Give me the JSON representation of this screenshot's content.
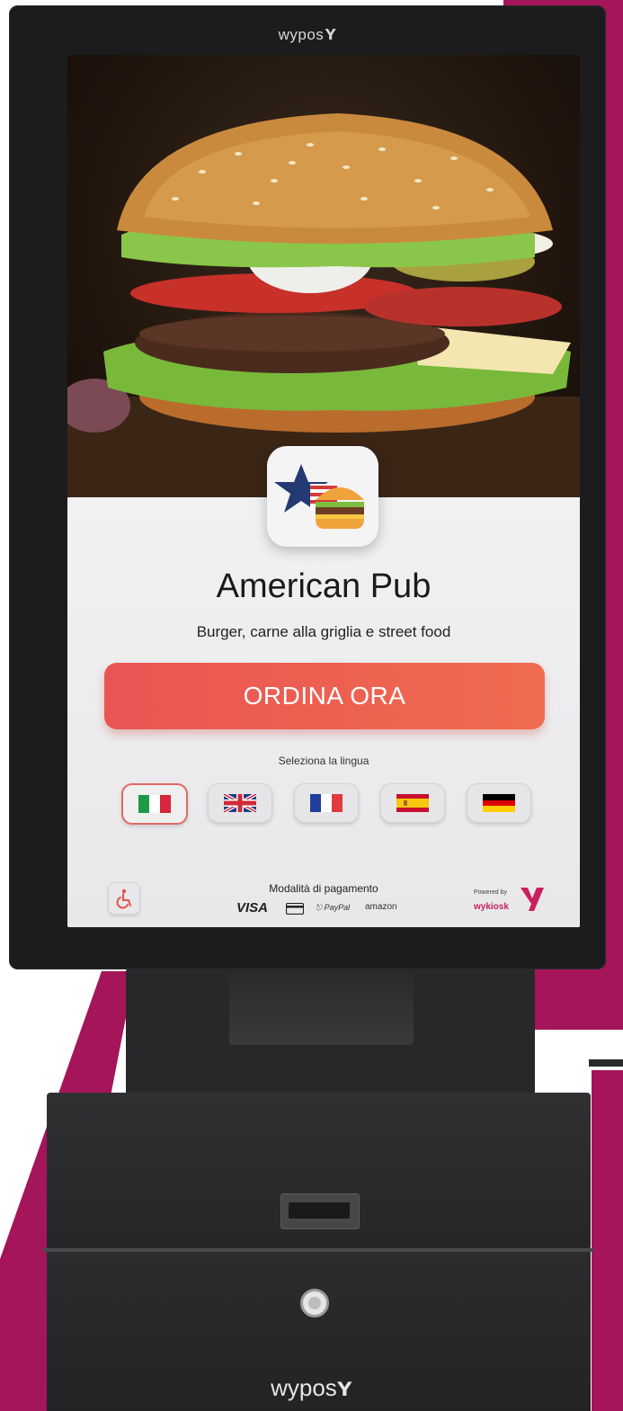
{
  "colors": {
    "accent_magenta": "#a5155a",
    "order_red": "#ea5453",
    "powered_brand": "#c9205a"
  },
  "frame": {
    "brand": "wypos"
  },
  "screen": {
    "title": "American Pub",
    "subtitle": "Burger, carne alla griglia e street food",
    "order_button_label": "ORDINA ORA",
    "language_label": "Seleziona la lingua",
    "languages": [
      {
        "name": "italian",
        "active": true
      },
      {
        "name": "english",
        "active": false
      },
      {
        "name": "french",
        "active": false
      },
      {
        "name": "spanish",
        "active": false
      },
      {
        "name": "german",
        "active": false
      }
    ],
    "payment": {
      "label": "Modalità di pagamento",
      "visa": "VISA",
      "paypal": "PayPal",
      "amazon": "amazon"
    },
    "powered": {
      "label": "Powered by",
      "brand": "wykiosk"
    },
    "icons": {
      "accessibility": "wheelchair-icon",
      "card": "credit-card-icon",
      "logo": "star-flag-burger-icon"
    }
  },
  "cabinet": {
    "brand": "wypos"
  }
}
